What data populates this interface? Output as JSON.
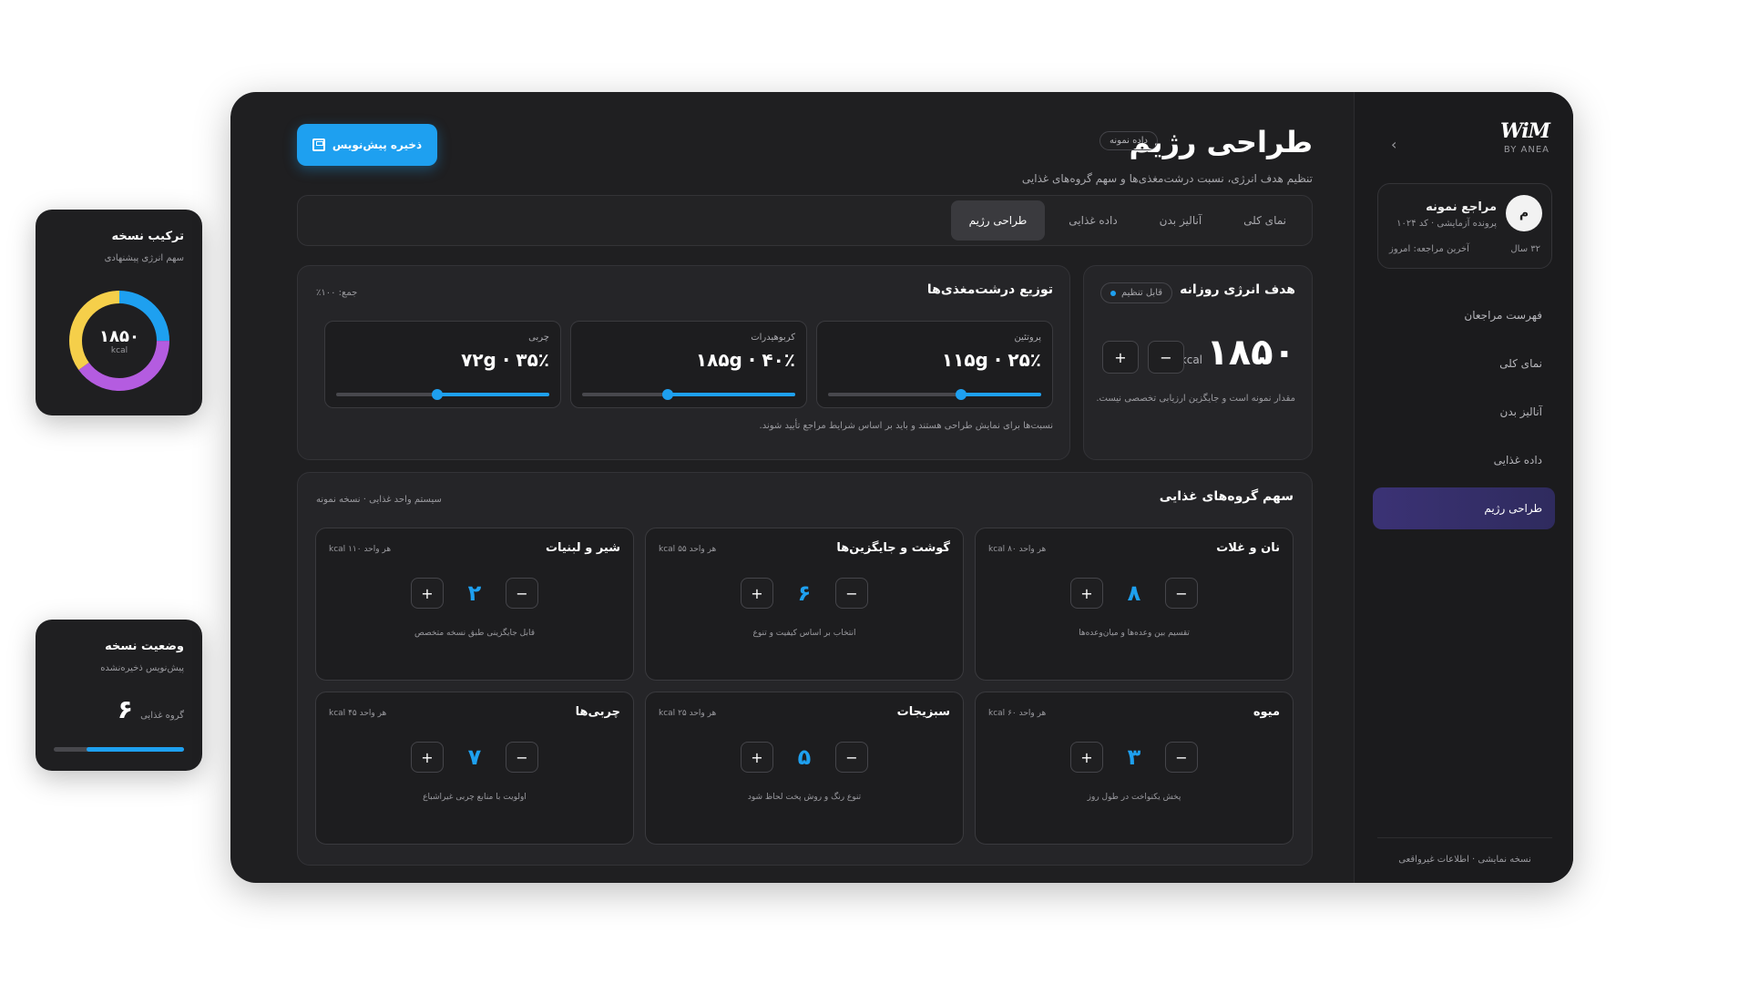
{
  "sidebar": {
    "logo": "WiM",
    "logo_sub": "BY ANEA",
    "collapse_icon": "›",
    "client": {
      "avatar": "م",
      "name": "مراجع نمونه",
      "file": "پرونده آزمایشی · کد ۱۰۲۴",
      "age": "۳۲ سال",
      "last_visit": "آخرین مراجعه: امروز"
    },
    "items": [
      {
        "label": "فهرست مراجعان"
      },
      {
        "label": "نمای کلی"
      },
      {
        "label": "آنالیز بدن"
      },
      {
        "label": "داده غذایی"
      },
      {
        "label": "طراحی رژیم"
      }
    ],
    "footer": "نسخه نمایشی · اطلاعات غیرواقعی"
  },
  "header": {
    "title": "طراحی رژیم",
    "badge": "داده نمونه",
    "subtitle": "تنظیم هدف انرژی، نسبت درشت‌مغذی‌ها و سهم گروه‌های غذایی",
    "save_label": "ذخیره پیش‌نویس"
  },
  "tabs": [
    {
      "label": "نمای کلی"
    },
    {
      "label": "آنالیز بدن"
    },
    {
      "label": "داده غذایی"
    },
    {
      "label": "طراحی رژیم"
    }
  ],
  "energy": {
    "title": "هدف انرژی روزانه",
    "badge": "قابل تنظیم",
    "value": "۱۸۵۰",
    "unit": "kcal",
    "minus": "−",
    "plus": "+",
    "note": "مقدار نمونه است و جایگزین ارزیابی تخصصی نیست."
  },
  "macros": {
    "title": "توزیع درشت‌مغذی‌ها",
    "total": "جمع: ۱۰۰٪",
    "note": "نسبت‌ها برای نمایش طراحی هستند و باید بر اساس شرایط مراجع تأیید شوند.",
    "items": [
      {
        "label": "پروتئین",
        "value": "۱۱۵g · ۲۵٪",
        "percent": 25
      },
      {
        "label": "کربوهیدرات",
        "value": "۱۸۵g · ۴۰٪",
        "percent": 40
      },
      {
        "label": "چربی",
        "value": "۷۲g · ۳۵٪",
        "percent": 35
      }
    ]
  },
  "food": {
    "title": "سهم گروه‌های غذایی",
    "subtitle": "سیستم واحد غذایی · نسخه نمونه",
    "minus": "−",
    "plus": "+",
    "groups": [
      {
        "name": "نان و غلات",
        "unit": "هر واحد ۸۰ kcal",
        "count": "۸",
        "desc": "تقسیم بین وعده‌ها و میان‌وعده‌ها"
      },
      {
        "name": "گوشت و جایگزین‌ها",
        "unit": "هر واحد ۵۵ kcal",
        "count": "۶",
        "desc": "انتخاب بر اساس کیفیت و تنوع"
      },
      {
        "name": "شیر و لبنیات",
        "unit": "هر واحد ۱۱۰ kcal",
        "count": "۲",
        "desc": "قابل جایگزینی طبق نسخه متخصص"
      },
      {
        "name": "میوه",
        "unit": "هر واحد ۶۰ kcal",
        "count": "۳",
        "desc": "پخش یکنواخت در طول روز"
      },
      {
        "name": "سبزیجات",
        "unit": "هر واحد ۲۵ kcal",
        "count": "۵",
        "desc": "تنوع رنگ و روش پخت لحاظ شود"
      },
      {
        "name": "چربی‌ها",
        "unit": "هر واحد ۴۵ kcal",
        "count": "۷",
        "desc": "اولویت با منابع چربی غیراشباع"
      }
    ]
  },
  "mix_card": {
    "title": "ترکیب نسخه",
    "subtitle": "سهم انرژی پیشنهادی",
    "value": "۱۸۵۰",
    "unit": "kcal",
    "segments": [
      {
        "percent": 25,
        "color": "#1ea0f0"
      },
      {
        "percent": 40,
        "color": "#b45ce0"
      },
      {
        "percent": 35,
        "color": "#f5cf4a"
      }
    ]
  },
  "status_card": {
    "title": "وضعیت نسخه",
    "subtitle": "پیش‌نویس ذخیره‌نشده",
    "count": "۶",
    "count_label": "گروه غذایی",
    "progress": 0.75
  },
  "colors": {
    "accent": "#1ea0f0",
    "purple": "#b45ce0",
    "yellow": "#f5cf4a"
  }
}
